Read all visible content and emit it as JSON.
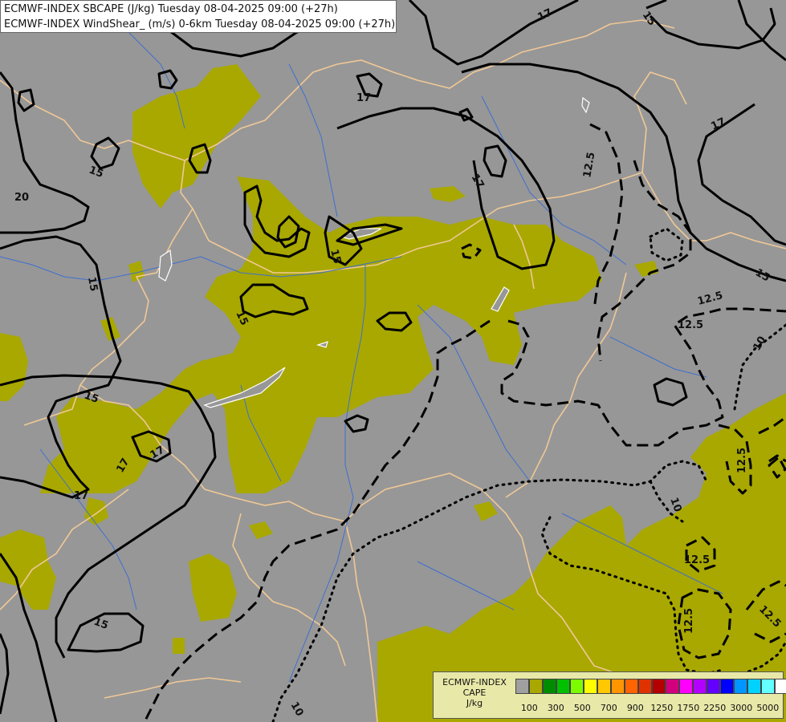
{
  "header": {
    "line1": "ECMWF-INDEX SBCAPE (J/kg) Tuesday 08-04-2025 09:00 (+27h)",
    "line2": "ECMWF-INDEX WindShear_ (m/s) 0-6km Tuesday 08-04-2025 09:00 (+27h)"
  },
  "map": {
    "background_color": "#979797",
    "cape_fill_color": "#a8a800",
    "border_color": "#f0c896",
    "river_color": "#3f6fd0",
    "contour_color": "#000000",
    "contour_labels": {
      "l1": "17",
      "l2": "15",
      "l3": "17",
      "l4": "17",
      "l5": "17",
      "l6": "15",
      "l7": "20",
      "l8": "15",
      "l9": "17",
      "l10": "12.5",
      "l11": "15",
      "l12": "15",
      "l13": "12.5",
      "l14": "12.5",
      "l15": "10",
      "l16": "15",
      "l17": "17",
      "l18": "17",
      "l19": "12.5",
      "l20": "10",
      "l21": "12.5",
      "l22": "15",
      "l23": "12.5",
      "l24": "12.5",
      "l25": "10",
      "l26": "15"
    }
  },
  "legend": {
    "title_line1": "ECMWF-INDEX",
    "title_line2": "CAPE",
    "title_line3": "J/kg",
    "colors": [
      "#a0a0a0",
      "#a8a800",
      "#008c00",
      "#00c000",
      "#7cfc00",
      "#ffff00",
      "#ffc800",
      "#ff9600",
      "#ff6400",
      "#e03200",
      "#b40000",
      "#d2007d",
      "#ff00ff",
      "#b400ff",
      "#6400ff",
      "#0000ff",
      "#0096ff",
      "#00d2ff",
      "#64ffff",
      "#ffffff"
    ],
    "ticks": [
      "100",
      "300",
      "500",
      "700",
      "900",
      "1250",
      "1750",
      "2250",
      "3000",
      "5000"
    ]
  }
}
